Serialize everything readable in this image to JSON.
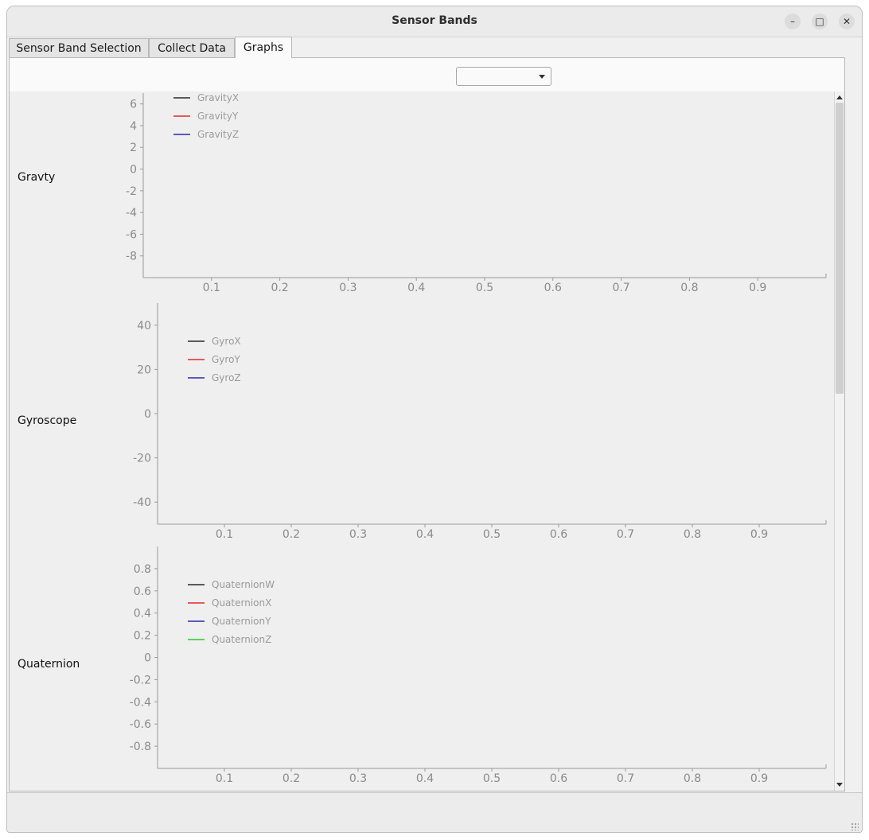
{
  "window": {
    "title": "Sensor Bands",
    "controls": {
      "minimize": "–",
      "maximize": "□",
      "close": "✕"
    }
  },
  "tabs": [
    {
      "label": "Sensor Band Selection",
      "active": false
    },
    {
      "label": "Collect Data",
      "active": false
    },
    {
      "label": "Graphs",
      "active": true
    }
  ],
  "toolbar": {
    "dropdown_value": ""
  },
  "charts": [
    {
      "row_label": "Gravty"
    },
    {
      "row_label": "Gyroscope"
    },
    {
      "row_label": "Quaternion"
    }
  ],
  "colors": {
    "series1": "#000000",
    "series2": "#e00000",
    "series3": "#0000a0",
    "series4": "#00c000",
    "axis_text": "#8a8a8a"
  },
  "chart_data": [
    {
      "type": "line",
      "title": "",
      "xlabel": "",
      "ylabel": "",
      "xlim": [
        0,
        1
      ],
      "ylim": [
        -10,
        7
      ],
      "x_ticks": [
        "0.1",
        "0.2",
        "0.3",
        "0.4",
        "0.5",
        "0.6",
        "0.7",
        "0.8",
        "0.9"
      ],
      "y_ticks": [
        "6",
        "4",
        "2",
        "0",
        "-2",
        "-4",
        "-6",
        "-8"
      ],
      "legend_position": "top-left",
      "grid": false,
      "series": [
        {
          "name": "GravityX",
          "color": "#000000",
          "x": [],
          "y": []
        },
        {
          "name": "GravityY",
          "color": "#e00000",
          "x": [],
          "y": []
        },
        {
          "name": "GravityZ",
          "color": "#0000a0",
          "x": [],
          "y": []
        }
      ]
    },
    {
      "type": "line",
      "title": "",
      "xlabel": "",
      "ylabel": "",
      "xlim": [
        0,
        1
      ],
      "ylim": [
        -50,
        50
      ],
      "x_ticks": [
        "0.1",
        "0.2",
        "0.3",
        "0.4",
        "0.5",
        "0.6",
        "0.7",
        "0.8",
        "0.9"
      ],
      "y_ticks": [
        "40",
        "20",
        "0",
        "-20",
        "-40"
      ],
      "legend_position": "top-left",
      "grid": false,
      "series": [
        {
          "name": "GyroX",
          "color": "#000000",
          "x": [],
          "y": []
        },
        {
          "name": "GyroY",
          "color": "#e00000",
          "x": [],
          "y": []
        },
        {
          "name": "GyroZ",
          "color": "#0000a0",
          "x": [],
          "y": []
        }
      ]
    },
    {
      "type": "line",
      "title": "",
      "xlabel": "",
      "ylabel": "",
      "xlim": [
        0,
        1
      ],
      "ylim": [
        -1,
        1
      ],
      "x_ticks": [
        "0.1",
        "0.2",
        "0.3",
        "0.4",
        "0.5",
        "0.6",
        "0.7",
        "0.8",
        "0.9"
      ],
      "y_ticks": [
        "0.8",
        "0.6",
        "0.4",
        "0.2",
        "0",
        "-0.2",
        "-0.4",
        "-0.6",
        "-0.8"
      ],
      "legend_position": "top-left",
      "grid": false,
      "series": [
        {
          "name": "QuaternionW",
          "color": "#000000",
          "x": [],
          "y": []
        },
        {
          "name": "QuaternionX",
          "color": "#e00000",
          "x": [],
          "y": []
        },
        {
          "name": "QuaternionY",
          "color": "#0000a0",
          "x": [],
          "y": []
        },
        {
          "name": "QuaternionZ",
          "color": "#00c000",
          "x": [],
          "y": []
        }
      ]
    }
  ]
}
